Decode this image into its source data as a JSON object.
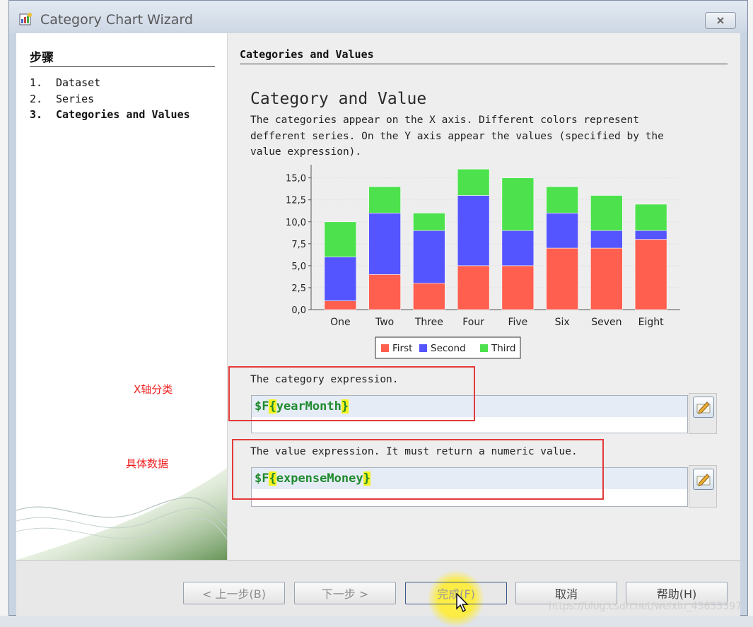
{
  "window": {
    "title": "Category Chart Wizard"
  },
  "sidebar": {
    "heading": "步骤",
    "steps": [
      {
        "num": "1.",
        "label": "Dataset"
      },
      {
        "num": "2.",
        "label": "Series"
      },
      {
        "num": "3.",
        "label": "Categories and Values"
      }
    ],
    "active_step": 3
  },
  "main": {
    "section_title": "Categories and Values",
    "heading": "Category and Value",
    "description": "The categories appear on the X axis. Different colors represent defferent series. On the Y axis appear the values (specified by the value expression).",
    "category_label": "The category expression.",
    "category_expr": {
      "prefix": "$F",
      "open": "{",
      "name": "yearMonth",
      "close": "}"
    },
    "value_label": "The value expression. It must return a numeric value.",
    "value_expr": {
      "prefix": "$F",
      "open": "{",
      "name": "expenseMoney",
      "close": "}"
    }
  },
  "annotations": {
    "x_axis_note": "X轴分类",
    "data_note": "具体数据"
  },
  "buttons": {
    "prev": "< 上一步(B)",
    "next": "下一步 >",
    "finish": "完成(F)",
    "cancel": "取消",
    "help": "帮助(H)"
  },
  "watermark": "https://blog.csdn.net/weixin_43655397",
  "icons": {
    "app": "report-wizard-icon",
    "close": "close-icon",
    "edit": "edit-expression-icon",
    "cursor": "mouse-cursor-icon"
  },
  "chart_data": {
    "type": "bar",
    "stacked": true,
    "categories": [
      "One",
      "Two",
      "Three",
      "Four",
      "Five",
      "Six",
      "Seven",
      "Eight"
    ],
    "series": [
      {
        "name": "First",
        "color": "#ff5f4f",
        "values": [
          1,
          4,
          3,
          5,
          5,
          7,
          7,
          8
        ]
      },
      {
        "name": "Second",
        "color": "#5555ff",
        "values": [
          5,
          7,
          6,
          8,
          4,
          4,
          2,
          1
        ]
      },
      {
        "name": "Third",
        "color": "#4de24d",
        "values": [
          4,
          3,
          2,
          3,
          6,
          3,
          4,
          3
        ]
      }
    ],
    "yticks": [
      "0,0",
      "2,5",
      "5,0",
      "7,5",
      "10,0",
      "12,5",
      "15,0"
    ],
    "ylim": [
      0,
      16.5
    ],
    "legend": "bottom"
  }
}
